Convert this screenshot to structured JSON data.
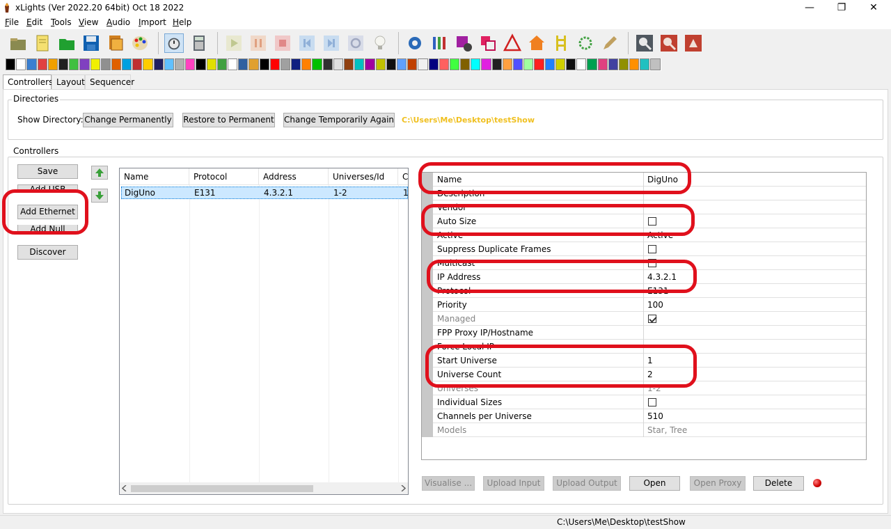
{
  "window": {
    "title": "xLights (Ver 2022.20 64bit) Oct 18 2022",
    "minimize_glyph": "—",
    "maximize_glyph": "❐",
    "close_glyph": "✕"
  },
  "menu": {
    "items": [
      {
        "key": "F",
        "rest": "ile"
      },
      {
        "key": "E",
        "rest": "dit"
      },
      {
        "key": "T",
        "rest": "ools"
      },
      {
        "key": "V",
        "rest": "iew"
      },
      {
        "key": "A",
        "rest": "udio"
      },
      {
        "key": "I",
        "rest": "mport"
      },
      {
        "key": "H",
        "rest": "elp"
      }
    ]
  },
  "toolbar": {
    "icons": [
      "open-folder-icon",
      "new-sequence-icon",
      "open-sequence-icon",
      "save-icon",
      "save-as-icon",
      "color-palette-icon",
      "timer-icon",
      "calculator-icon",
      "play-icon",
      "pause-icon",
      "stop-icon",
      "rewind-icon",
      "fast-forward-icon",
      "replay-icon",
      "lightbulb-icon",
      "settings-gear-icon",
      "pixel-strings-icon",
      "model-settings-icon",
      "layers-icon",
      "warning-triangle-icon",
      "house-icon",
      "ladder-icon",
      "starburst-icon",
      "pencil-icon",
      "zoom-in-icon",
      "zoom-out-icon",
      "export-icon"
    ],
    "effect_icon_colors": [
      "#000000",
      "#ffffff",
      "#3a7fd0",
      "#e04040",
      "#f0a000",
      "#202020",
      "#40c040",
      "#8040c0",
      "#f0f000",
      "#909090",
      "#e06000",
      "#00a0e0",
      "#c03030",
      "#ffcc00",
      "#202060",
      "#60c0ff",
      "#b0b0b0",
      "#ff40c0",
      "#000000",
      "#e0e000",
      "#40a040",
      "#ffffff",
      "#3060a0",
      "#e0a030",
      "#000000",
      "#ff0000",
      "#a0a0a0",
      "#102080",
      "#ff8000",
      "#00c000",
      "#303030",
      "#e0e0e0",
      "#904010",
      "#00c0c0",
      "#a000a0",
      "#c0c000",
      "#101010",
      "#60a0ff",
      "#c04000",
      "#f0f0f0",
      "#000080",
      "#ff6060",
      "#40ff40",
      "#806000",
      "#00ffff",
      "#e020e0",
      "#202020",
      "#ffa040",
      "#5050ff",
      "#a0ffa0",
      "#ff2020",
      "#2080ff",
      "#d0d000",
      "#101010",
      "#ffffff",
      "#00a050",
      "#e04080",
      "#4040a0",
      "#909000",
      "#ff9000",
      "#20c0c0",
      "#c0c0c0"
    ]
  },
  "tabs": [
    {
      "label": "Controllers",
      "active": true
    },
    {
      "label": "Layout",
      "active": false
    },
    {
      "label": "Sequencer",
      "active": false
    }
  ],
  "directories": {
    "group_label": "Directories",
    "show_dir_label": "Show Directory:",
    "btn_change_perm": "Change Permanently",
    "btn_restore": "Restore to Permanent",
    "btn_change_temp": "Change Temporarily Again",
    "path": "C:\\Users\\Me\\Desktop\\testShow"
  },
  "controllers": {
    "group_label": "Controllers",
    "btn_save": "Save",
    "btn_add_usb": "Add USB",
    "btn_add_ethernet": "Add Ethernet",
    "btn_add_null": "Add Null",
    "btn_discover": "Discover",
    "columns": [
      "Name",
      "Protocol",
      "Address",
      "Universes/Id",
      "C"
    ],
    "rows": [
      {
        "name": "DigUno",
        "protocol": "E131",
        "address": "4.3.2.1",
        "universes": "1-2",
        "c": "1"
      }
    ]
  },
  "properties": [
    {
      "name": "Name",
      "value": "DigUno",
      "type": "text"
    },
    {
      "name": "Description",
      "value": "",
      "type": "text"
    },
    {
      "name": "Vendor",
      "value": "",
      "type": "text"
    },
    {
      "name": "Auto Size",
      "value": false,
      "type": "check"
    },
    {
      "name": "Active",
      "value": "Active",
      "type": "text"
    },
    {
      "name": "Suppress Duplicate Frames",
      "value": false,
      "type": "check"
    },
    {
      "name": "Multicast",
      "value": false,
      "type": "check"
    },
    {
      "name": "IP Address",
      "value": "4.3.2.1",
      "type": "text"
    },
    {
      "name": "Protocol",
      "value": "E131",
      "type": "text"
    },
    {
      "name": "Priority",
      "value": "100",
      "type": "text"
    },
    {
      "name": "Managed",
      "value": true,
      "type": "check",
      "disabled": true
    },
    {
      "name": "FPP Proxy IP/Hostname",
      "value": "",
      "type": "text"
    },
    {
      "name": "Force Local IP",
      "value": "",
      "type": "text"
    },
    {
      "name": "Start Universe",
      "value": "1",
      "type": "text"
    },
    {
      "name": "Universe Count",
      "value": "2",
      "type": "text"
    },
    {
      "name": "Universes",
      "value": "1-2",
      "type": "text",
      "disabled": true
    },
    {
      "name": "Individual Sizes",
      "value": false,
      "type": "check"
    },
    {
      "name": "Channels per Universe",
      "value": "510",
      "type": "text"
    },
    {
      "name": "Models",
      "value": "Star, Tree",
      "type": "text",
      "disabled": true
    }
  ],
  "actions": {
    "visualise": "Visualise ...",
    "upload_input": "Upload Input",
    "upload_output": "Upload Output",
    "open": "Open",
    "open_proxy": "Open Proxy",
    "delete": "Delete"
  },
  "status": {
    "path": "C:\\Users\\Me\\Desktop\\testShow"
  },
  "colors": {
    "annotation_red": "#e0101c",
    "path_yellow": "#f0c020",
    "selection_blue": "#cce8ff"
  }
}
